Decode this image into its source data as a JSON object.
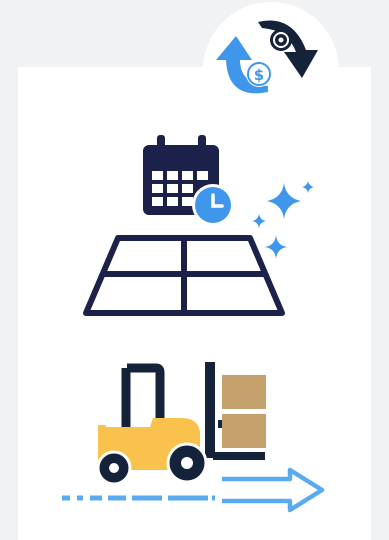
{
  "colors": {
    "page_background": "#f1f2f4",
    "card_background": "#ffffff",
    "navy": "#1b2148",
    "sky_blue": "#3f96ea",
    "forklift_yellow": "#f8c24d",
    "forklift_dark": "#14233a",
    "crate_tan": "#c4a06c",
    "arrow_blue": "#5aaaf0"
  },
  "icons": {
    "badge": "cost-cycle-icon",
    "calendar": "calendar-clock-icon",
    "sparkle": "sparkle-icon",
    "floor": "floor-grid-icon",
    "forklift": "forklift-icon",
    "crates": "crate-icon",
    "arrow": "motion-arrow-icon"
  }
}
